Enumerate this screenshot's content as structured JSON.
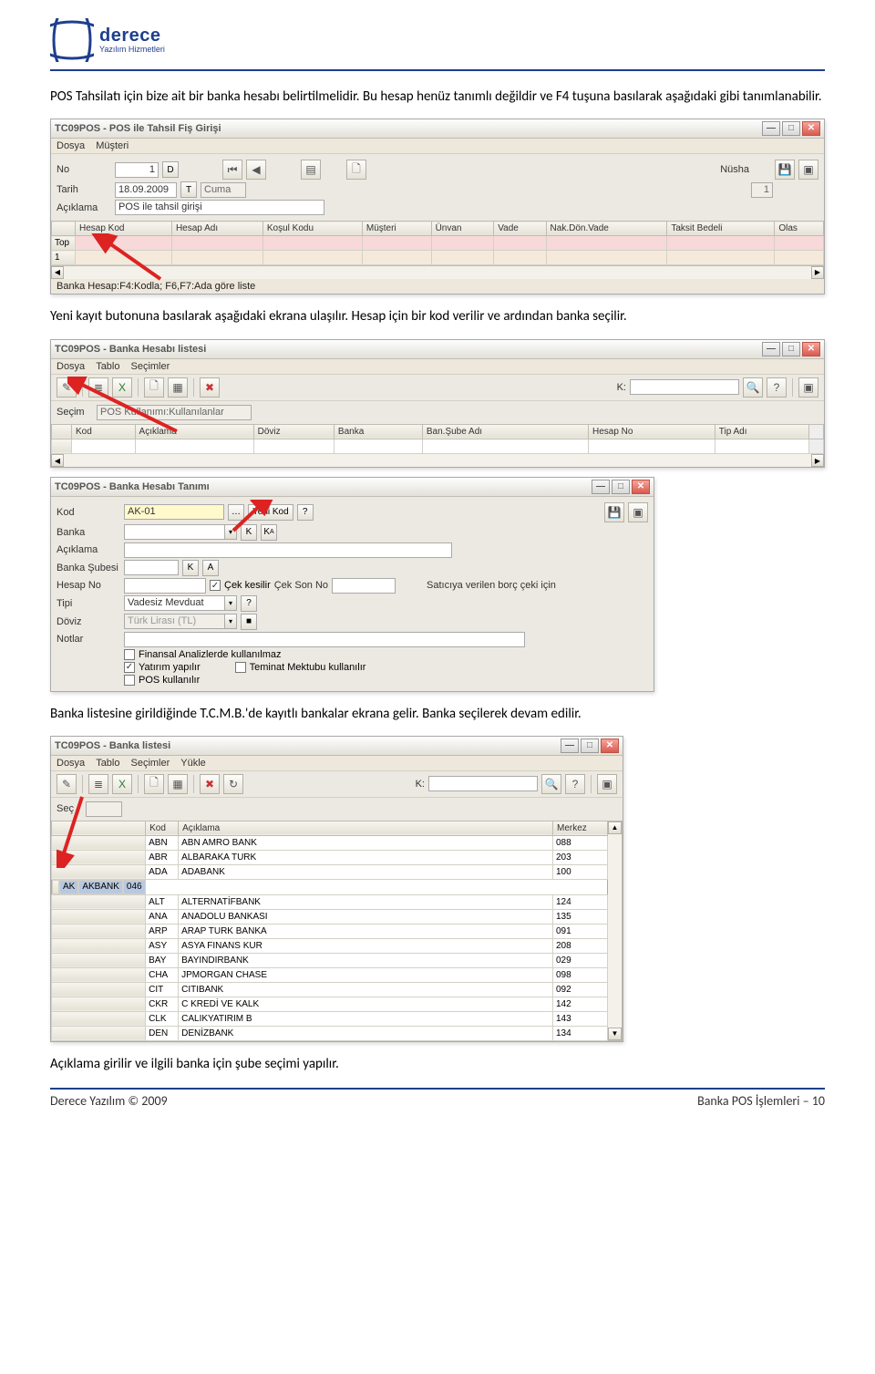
{
  "logo": {
    "brand": "derece",
    "sub": "Yazılım Hizmetleri"
  },
  "para1": "POS Tahsilatı için bize ait bir banka hesabı belirtilmelidir. Bu hesap henüz tanımlı değildir ve F4 tuşuna basılarak aşağıdaki gibi tanımlanabilir.",
  "para2": "Yeni kayıt butonuna basılarak aşağıdaki ekrana ulaşılır. Hesap için bir kod verilir ve ardından banka seçilir.",
  "para3": "Banka listesine girildiğinde T.C.M.B.'de kayıtlı bankalar ekrana gelir. Banka seçilerek devam edilir.",
  "para4": "Açıklama girilir ve ilgili banka için şube seçimi yapılır.",
  "win1": {
    "title": "TC09POS - POS ile Tahsil Fiş Girişi",
    "menu": [
      "Dosya",
      "Müşteri"
    ],
    "labels": {
      "no": "No",
      "tarih": "Tarih",
      "aciklama": "Açıklama",
      "nusha": "Nüsha"
    },
    "no_val": "1",
    "no_d": "D",
    "tarih_val": "18.09.2009",
    "tarih_t": "T",
    "tarih_day": "Cuma",
    "aciklama_val": "POS ile tahsil girişi",
    "nusha_val": "1",
    "cols": [
      "Hesap Kod",
      "Hesap Adı",
      "Koşul Kodu",
      "Müşteri",
      "Ünvan",
      "Vade",
      "Nak.Dön.Vade",
      "Taksit Bedeli",
      "Olas"
    ],
    "rowlabels": [
      "Top",
      "1"
    ],
    "status": "Banka Hesap:F4:Kodla; F6,F7:Ada göre liste"
  },
  "win2": {
    "title": "TC09POS - Banka Hesabı listesi",
    "menu": [
      "Dosya",
      "Tablo",
      "Seçimler"
    ],
    "klabel": "K:",
    "secim_lbl": "Seçim",
    "secim_val": "POS Kullanımı:Kullanılanlar",
    "cols": [
      "Kod",
      "Açıklama",
      "Döviz",
      "Banka",
      "Ban.Şube Adı",
      "Hesap No",
      "Tip Adı"
    ]
  },
  "win3": {
    "title": "TC09POS - Banka Hesabı Tanımı",
    "labels": {
      "kod": "Kod",
      "yenikod": "Yeni Kod",
      "banka": "Banka",
      "aciklama": "Açıklama",
      "bankasubesi": "Banka Şubesi",
      "hesapno": "Hesap No",
      "ceksonno": "Çek Son No",
      "tipi": "Tipi",
      "doviz": "Döviz",
      "notlar": "Notlar"
    },
    "kod_val": "AK-01",
    "cekkesilir": "Çek kesilir",
    "saticiya": "Satıcıya verilen borç çeki için",
    "tipi_val": "Vadesiz Mevduat",
    "doviz_val": "Türk Lirası (TL)",
    "opt_finansal": "Finansal Analizlerde kullanılmaz",
    "opt_yatirim": "Yatırım yapılır",
    "opt_teminat": "Teminat Mektubu kullanılır",
    "opt_pos": "POS kullanılır"
  },
  "win4": {
    "title": "TC09POS - Banka listesi",
    "menu": [
      "Dosya",
      "Tablo",
      "Seçimler",
      "Yükle"
    ],
    "klabel": "K:",
    "seclabel": "Seç",
    "cols": [
      "Kod",
      "Açıklama",
      "Merkez"
    ],
    "rows": [
      [
        "ABN",
        "ABN AMRO BANK",
        "088"
      ],
      [
        "ABR",
        "ALBARAKA TURK",
        "203"
      ],
      [
        "ADA",
        "ADABANK",
        "100"
      ],
      [
        "AK",
        "AKBANK",
        "046"
      ],
      [
        "ALT",
        "ALTERNATİFBANK",
        "124"
      ],
      [
        "ANA",
        "ANADOLU BANKASI",
        "135"
      ],
      [
        "ARP",
        "ARAP TURK BANKA",
        "091"
      ],
      [
        "ASY",
        "ASYA FINANS KUR",
        "208"
      ],
      [
        "BAY",
        "BAYINDIRBANK",
        "029"
      ],
      [
        "CHA",
        "JPMORGAN CHASE",
        "098"
      ],
      [
        "CIT",
        "CITIBANK",
        "092"
      ],
      [
        "CKR",
        "C KREDİ VE KALK",
        "142"
      ],
      [
        "CLK",
        "CALIKYATIRIM B",
        "143"
      ],
      [
        "DEN",
        "DENİZBANK",
        "134"
      ]
    ]
  },
  "footer": {
    "left": "Derece Yazılım © 2009",
    "right": "Banka POS İşlemleri – 10"
  }
}
